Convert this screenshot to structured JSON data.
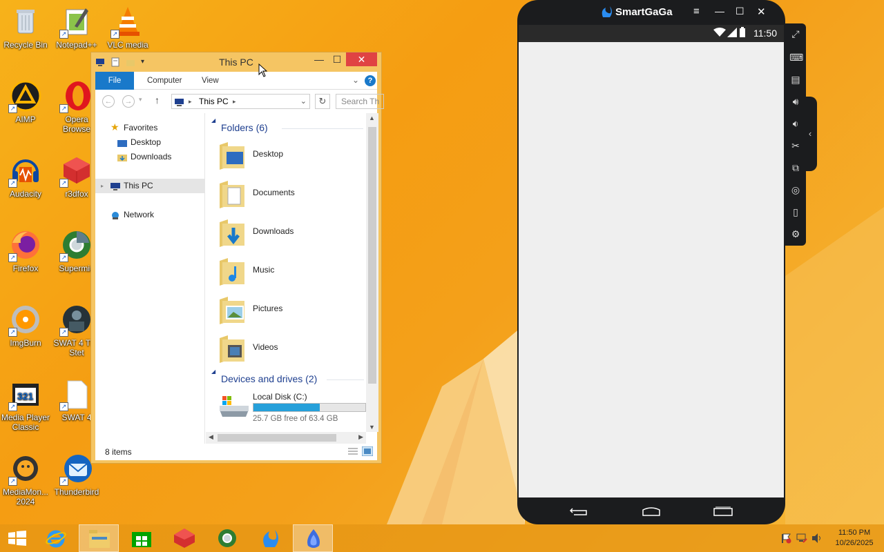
{
  "desktop": {
    "icons": [
      {
        "label": "Recycle Bin",
        "icon": "recycle-bin-icon"
      },
      {
        "label": "Notepad++",
        "icon": "notepadpp-icon"
      },
      {
        "label": "VLC media",
        "icon": "vlc-icon"
      },
      {
        "label": "AIMP",
        "icon": "aimp-icon"
      },
      {
        "label": "Opera Browse",
        "icon": "opera-icon"
      },
      {
        "label": "Audacity",
        "icon": "audacity-icon"
      },
      {
        "label": "r3dfox",
        "icon": "r3dfox-icon"
      },
      {
        "label": "Firefox",
        "icon": "firefox-icon"
      },
      {
        "label": "Supermiu",
        "icon": "supermium-icon"
      },
      {
        "label": "ImgBurn",
        "icon": "imgburn-icon"
      },
      {
        "label": "SWAT 4 The Stet",
        "icon": "swat4-icon"
      },
      {
        "label": "Media Player Classic",
        "icon": "mpc-icon"
      },
      {
        "label": "SWAT 4",
        "icon": "file-icon"
      },
      {
        "label": "MediaMon... 2024",
        "icon": "mediamonkey-icon"
      },
      {
        "label": "Thunderbird",
        "icon": "thunderbird-icon"
      }
    ]
  },
  "explorer": {
    "title": "This PC",
    "ribbon_tabs": [
      "File",
      "Computer",
      "View"
    ],
    "address": "This PC",
    "search_placeholder": "Search Th",
    "nav": {
      "favorites": "Favorites",
      "desktop": "Desktop",
      "downloads": "Downloads",
      "this_pc": "This PC",
      "network": "Network"
    },
    "folders_header": "Folders (6)",
    "folders": [
      "Desktop",
      "Documents",
      "Downloads",
      "Music",
      "Pictures",
      "Videos"
    ],
    "devices_header": "Devices and drives (2)",
    "drive": {
      "name": "Local Disk (C:)",
      "free": "25.7 GB free of 63.4 GB",
      "used_fraction": 0.595
    },
    "status": "8 items"
  },
  "phone": {
    "app_name": "SmartGaGa",
    "time": "11:50"
  },
  "taskbar": {
    "time": "11:50 PM",
    "date": "10/26/2025"
  },
  "colors": {
    "accent": "#1979ca",
    "desktop_bg": "#f5a315",
    "close_red": "#e04343"
  }
}
